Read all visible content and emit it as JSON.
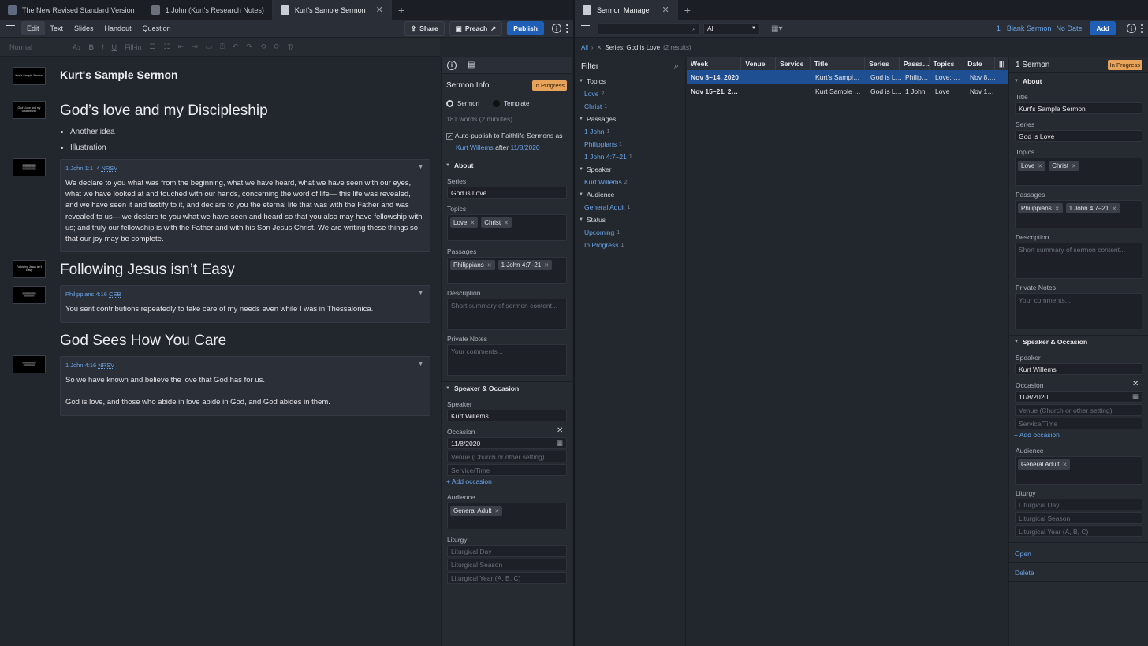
{
  "left": {
    "tabs": [
      {
        "label": "The New Revised Standard Version"
      },
      {
        "label": "1 John (Kurt's Research Notes)"
      },
      {
        "label": "Kurt's Sample Sermon"
      }
    ],
    "toolbar": {
      "modes": [
        "Edit",
        "Text",
        "Slides",
        "Handout",
        "Question"
      ],
      "share": "Share",
      "preach": "Preach",
      "publish": "Publish"
    },
    "format": {
      "style": "Normal",
      "fillin": "Fill-in"
    },
    "doc": {
      "title": "Kurt's Sample Sermon",
      "h1": "God’s love and my Discipleship",
      "bullets": [
        "Another idea",
        "Illustration"
      ],
      "passage1": {
        "ref": "1 John 1:1–4",
        "version": "NRSV",
        "text": "We declare to you what was from the beginning, what we have heard, what we have seen with our eyes, what we have looked at and touched with our hands, concerning the word of life— this life was revealed, and we have seen it and testify to it, and declare to you the eternal life that was with the Father and was revealed to us— we declare to you what we have seen and heard so that you also may have fellowship with us; and truly our fellowship is with the Father and with his Son Jesus Christ. We are writing these things so that our joy may be complete."
      },
      "h2": "Following Jesus isn’t Easy",
      "passage2": {
        "ref": "Philippians 4:16",
        "version": "CEB",
        "text": "You sent contributions repeatedly to take care of my needs even while I was in Thessalonica."
      },
      "h3": "God Sees How You Care",
      "passage3": {
        "ref": "1 John 4:16",
        "version": "NRSV",
        "text1": "So we have known and believe the love that God has for us.",
        "text2": "God is love, and those who abide in love abide in God, and God abides in them."
      },
      "thumbs": [
        "Kurt's Sample Sermon",
        "God's love and my Discipleship",
        "",
        "Following Jesus isn't Easy",
        "",
        ""
      ]
    },
    "info": {
      "title": "Sermon Info",
      "status": "In Progress",
      "radio_sermon": "Sermon",
      "radio_template": "Template",
      "words": "181 words (2 minutes)",
      "autopublish": "Auto-publish to Faithlife Sermons as",
      "author": "Kurt Willems",
      "after": "after",
      "date": "11/8/2020",
      "about": "About",
      "series_label": "Series",
      "series": "God is Love",
      "topics_label": "Topics",
      "topics": [
        "Love",
        "Christ"
      ],
      "passages_label": "Passages",
      "passages": [
        "Philippians",
        "1 John 4:7–21"
      ],
      "description_label": "Description",
      "description_ph": "Short summary of sermon content...",
      "notes_label": "Private Notes",
      "notes_ph": "Your comments...",
      "speaker_section": "Speaker & Occasion",
      "speaker_label": "Speaker",
      "speaker": "Kurt Willems",
      "occasion_label": "Occasion",
      "occasion_date": "11/8/2020",
      "venue_ph": "Venue (Church or other setting)",
      "service_ph": "Service/Time",
      "add_occasion": "+ Add occasion",
      "audience_label": "Audience",
      "audience": [
        "General Adult"
      ],
      "liturgy_label": "Liturgy",
      "lit_day": "Liturgical Day",
      "lit_season": "Liturgical Season",
      "lit_year": "Liturgical Year (A, B, C)"
    }
  },
  "right": {
    "tab": "Sermon Manager",
    "filter_select": "All",
    "count": "1",
    "blank_sermon": "Blank Sermon",
    "no_date": "No Date",
    "add": "Add",
    "breadcrumb_all": "All",
    "breadcrumb_series": "Series: God is Love",
    "breadcrumb_results": "(2 results)",
    "filter_title": "Filter",
    "filters": [
      {
        "head": "Topics",
        "items": [
          {
            "label": "Love",
            "n": "2"
          },
          {
            "label": "Christ",
            "n": "1"
          }
        ]
      },
      {
        "head": "Passages",
        "items": [
          {
            "label": "1 John",
            "n": "1"
          },
          {
            "label": "Philippians",
            "n": "1"
          },
          {
            "label": "1 John 4:7–21",
            "n": "1"
          }
        ]
      },
      {
        "head": "Speaker",
        "items": [
          {
            "label": "Kurt Willems",
            "n": "2"
          }
        ]
      },
      {
        "head": "Audience",
        "items": [
          {
            "label": "General Adult",
            "n": "1"
          }
        ]
      },
      {
        "head": "Status",
        "items": [
          {
            "label": "Upcoming",
            "n": "1"
          },
          {
            "label": "In Progress",
            "n": "1"
          }
        ]
      }
    ],
    "columns": [
      "Week",
      "Venue",
      "Service",
      "Title",
      "Series",
      "Passa…",
      "Topics",
      "Date"
    ],
    "rows": [
      [
        "Nov 8–14, 2020",
        "",
        "",
        "Kurt's Sampl…",
        "God is L…",
        "Philip…",
        "Love; …",
        "Nov 8,…"
      ],
      [
        "Nov 15–21, 2…",
        "",
        "",
        "Kurt Sample …",
        "God is L…",
        "1 John",
        "Love",
        "Nov 1…"
      ]
    ],
    "detail": {
      "count": "1 Sermon",
      "status": "In Progress",
      "about": "About",
      "title_label": "Title",
      "title": "Kurt's Sample Sermon",
      "series_label": "Series",
      "series": "God is Love",
      "topics_label": "Topics",
      "topics": [
        "Love",
        "Christ"
      ],
      "passages_label": "Passages",
      "passages": [
        "Philippians",
        "1 John 4:7–21"
      ],
      "description_label": "Description",
      "description_ph": "Short summary of sermon content...",
      "notes_label": "Private Notes",
      "notes_ph": "Your comments...",
      "speaker_section": "Speaker & Occasion",
      "speaker_label": "Speaker",
      "speaker": "Kurt Willems",
      "occasion_label": "Occasion",
      "occasion_date": "11/8/2020",
      "venue_ph": "Venue (Church or other setting)",
      "service_ph": "Service/Time",
      "add_occasion": "+ Add occasion",
      "audience_label": "Audience",
      "audience": [
        "General Adult"
      ],
      "liturgy_label": "Liturgy",
      "lit_day": "Liturgical Day",
      "lit_season": "Liturgical Season",
      "lit_year": "Liturgical Year (A, B, C)",
      "open": "Open",
      "delete": "Delete"
    }
  }
}
